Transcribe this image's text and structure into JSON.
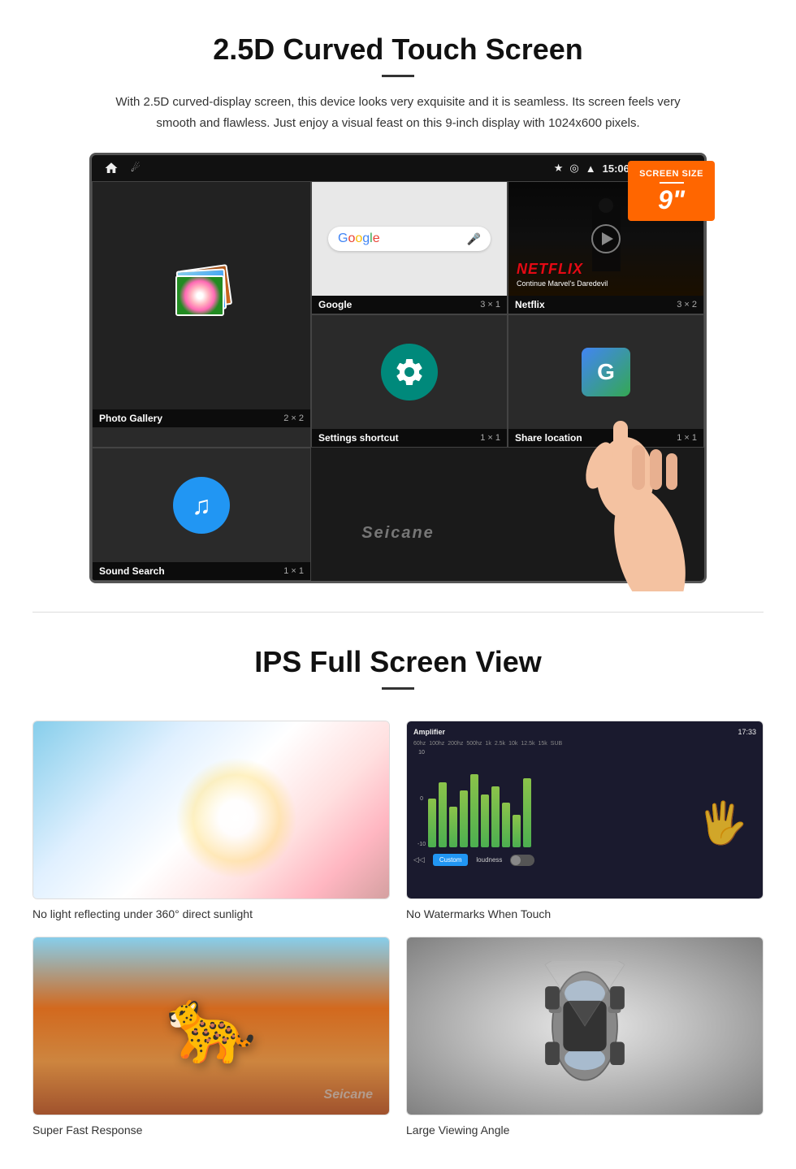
{
  "section1": {
    "title": "2.5D Curved Touch Screen",
    "description": "With 2.5D curved-display screen, this device looks very exquisite and it is seamless. Its screen feels very smooth and flawless. Just enjoy a visual feast on this 9-inch display with 1024x600 pixels.",
    "badge": {
      "top_text": "Screen Size",
      "size": "9\""
    },
    "statusBar": {
      "time": "15:06"
    },
    "apps": [
      {
        "name": "Google",
        "size": "3 × 1"
      },
      {
        "name": "Netflix",
        "size": "3 × 2",
        "subtitle": "Continue Marvel's Daredevil"
      },
      {
        "name": "Photo Gallery",
        "size": "2 × 2"
      },
      {
        "name": "Settings shortcut",
        "size": "1 × 1"
      },
      {
        "name": "Share location",
        "size": "1 × 1"
      },
      {
        "name": "Sound Search",
        "size": "1 × 1"
      }
    ],
    "watermark": "Seicane"
  },
  "section2": {
    "title": "IPS Full Screen View",
    "features": [
      {
        "label": "No light reflecting under 360° direct sunlight",
        "type": "sunlight"
      },
      {
        "label": "No Watermarks When Touch",
        "type": "equalizer"
      },
      {
        "label": "Super Fast Response",
        "type": "cheetah"
      },
      {
        "label": "Large Viewing Angle",
        "type": "car"
      }
    ],
    "watermark": "Seicane"
  }
}
